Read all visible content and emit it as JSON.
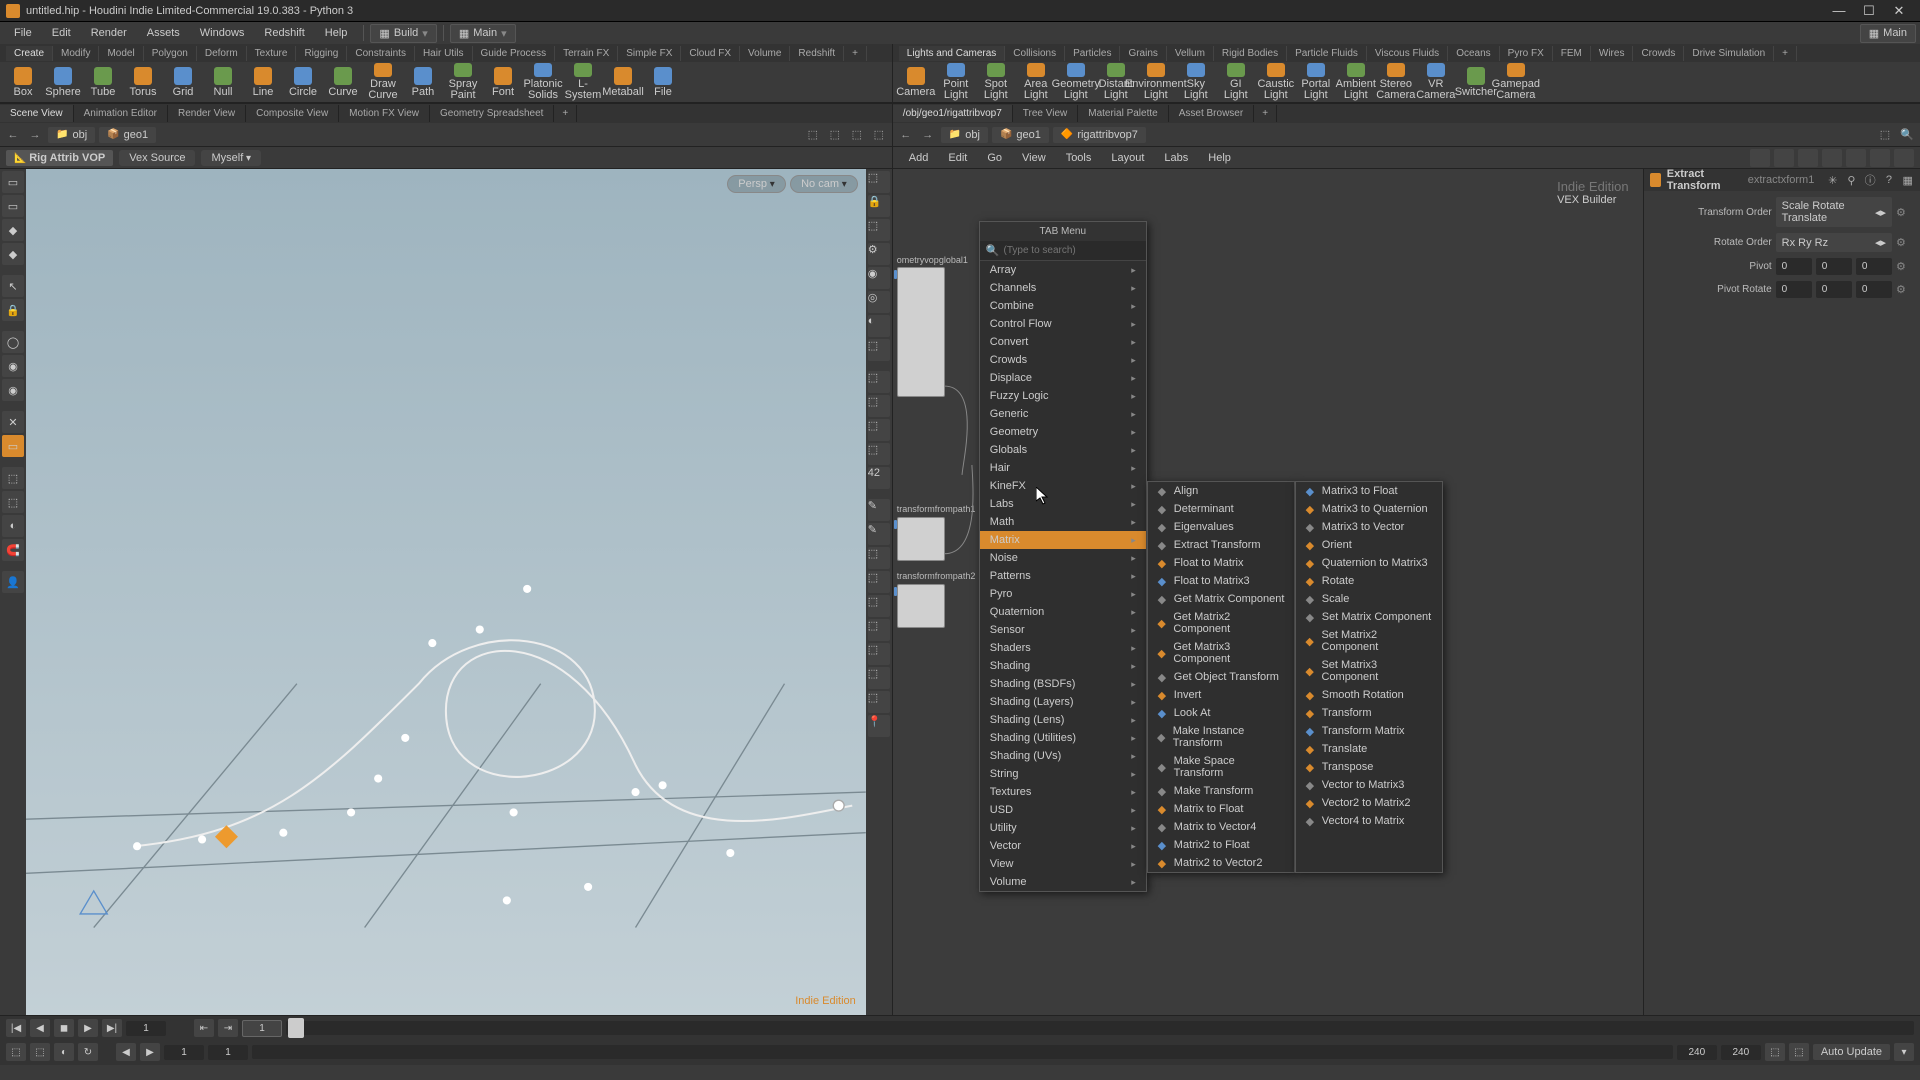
{
  "title": "untitled.hip - Houdini Indie Limited-Commercial 19.0.383 - Python 3",
  "menus": [
    "File",
    "Edit",
    "Render",
    "Assets",
    "Windows",
    "Redshift",
    "Help"
  ],
  "desktops": {
    "left": "Build",
    "right": "Main",
    "top_right": "Main"
  },
  "shelves_left": {
    "tabs": [
      "Create",
      "Modify",
      "Model",
      "Polygon",
      "Deform",
      "Texture",
      "Rigging",
      "Constraints",
      "Hair Utils",
      "Guide Process",
      "Terrain FX",
      "Simple FX",
      "Cloud FX",
      "Volume",
      "Redshift"
    ],
    "items": [
      "Box",
      "Sphere",
      "Tube",
      "Torus",
      "Grid",
      "Null",
      "Line",
      "Circle",
      "Curve",
      "Draw Curve",
      "Path",
      "Spray Paint",
      "Font",
      "Platonic Solids",
      "L-System",
      "Metaball",
      "File"
    ]
  },
  "shelves_right": {
    "tabs": [
      "Lights and Cameras",
      "Collisions",
      "Particles",
      "Grains",
      "Vellum",
      "Rigid Bodies",
      "Particle Fluids",
      "Viscous Fluids",
      "Oceans",
      "Pyro FX",
      "FEM",
      "Wires",
      "Crowds",
      "Drive Simulation"
    ],
    "items": [
      "Camera",
      "Point Light",
      "Spot Light",
      "Area Light",
      "Geometry Light",
      "Distant Light",
      "Environment Light",
      "Sky Light",
      "GI Light",
      "Caustic Light",
      "Portal Light",
      "Ambient Light",
      "Stereo Camera",
      "VR Camera",
      "Switcher",
      "Gamepad Camera"
    ]
  },
  "panetabs_left": [
    "Scene View",
    "Animation Editor",
    "Render View",
    "Composite View",
    "Motion FX View",
    "Geometry Spreadsheet"
  ],
  "panetabs_right": [
    "/obj/geo1/rigattribvop7",
    "Tree View",
    "Material Palette",
    "Asset Browser"
  ],
  "path_left": {
    "root": "obj",
    "child": "geo1"
  },
  "path_right": {
    "root": "obj",
    "child": "geo1",
    "leaf": "rigattribvop7"
  },
  "viewopts": {
    "label": "Rig Attrib VOP",
    "vex": "Vex Source",
    "who": "Myself"
  },
  "viewport": {
    "persp": "Persp",
    "cam": "No cam",
    "watermark": "Indie Edition"
  },
  "netmenu": [
    "Add",
    "Edit",
    "Go",
    "View",
    "Tools",
    "Layout",
    "Labs",
    "Help"
  ],
  "netheader": {
    "sub": "Indie Edition",
    "main": "VEX Builder"
  },
  "nodes": {
    "a": "ometryvopglobal1",
    "b": "transformfrompath1",
    "c": "transformfrompath2"
  },
  "parm": {
    "type": "Extract Transform",
    "name": "extractxform1",
    "rows": [
      {
        "lbl": "Transform Order",
        "kind": "dd",
        "val": "Scale Rotate Translate"
      },
      {
        "lbl": "Rotate Order",
        "kind": "dd",
        "val": "Rx Ry Rz"
      },
      {
        "lbl": "Pivot",
        "kind": "vec",
        "v": [
          "0",
          "0",
          "0"
        ]
      },
      {
        "lbl": "Pivot Rotate",
        "kind": "vec",
        "v": [
          "0",
          "0",
          "0"
        ]
      }
    ]
  },
  "tabmenu": {
    "title": "TAB Menu",
    "placeholder": "(Type to search)",
    "items": [
      "Array",
      "Channels",
      "Combine",
      "Control Flow",
      "Convert",
      "Crowds",
      "Displace",
      "Fuzzy Logic",
      "Generic",
      "Geometry",
      "Globals",
      "Hair",
      "KineFX",
      "Labs",
      "Math",
      "Matrix",
      "Noise",
      "Patterns",
      "Pyro",
      "Quaternion",
      "Sensor",
      "Shaders",
      "Shading",
      "Shading (BSDFs)",
      "Shading (Layers)",
      "Shading (Lens)",
      "Shading (Utilities)",
      "Shading (UVs)",
      "String",
      "Textures",
      "USD",
      "Utility",
      "Vector",
      "View",
      "Volume"
    ],
    "highlight": "Matrix"
  },
  "submenu_col1": [
    "Align",
    "Determinant",
    "Eigenvalues",
    "Extract Transform",
    "Float to Matrix",
    "Float to Matrix3",
    "Get Matrix Component",
    "Get Matrix2 Component",
    "Get Matrix3 Component",
    "Get Object Transform",
    "Invert",
    "Look At",
    "Make Instance Transform",
    "Make Space Transform",
    "Make Transform",
    "Matrix to Float",
    "Matrix to Vector4",
    "Matrix2 to Float",
    "Matrix2 to Vector2"
  ],
  "submenu_col2": [
    "Matrix3 to Float",
    "Matrix3 to Quaternion",
    "Matrix3 to Vector",
    "Orient",
    "Quaternion to Matrix3",
    "Rotate",
    "Scale",
    "Set Matrix Component",
    "Set Matrix2 Component",
    "Set Matrix3 Component",
    "Smooth Rotation",
    "Transform",
    "Transform Matrix",
    "Translate",
    "Transpose",
    "Vector to Matrix3",
    "Vector2 to Matrix2",
    "Vector4 to Matrix"
  ],
  "timeline": {
    "cur": "1",
    "start": "1",
    "end": "240",
    "end2": "240",
    "autoupdate": "Auto Update"
  }
}
